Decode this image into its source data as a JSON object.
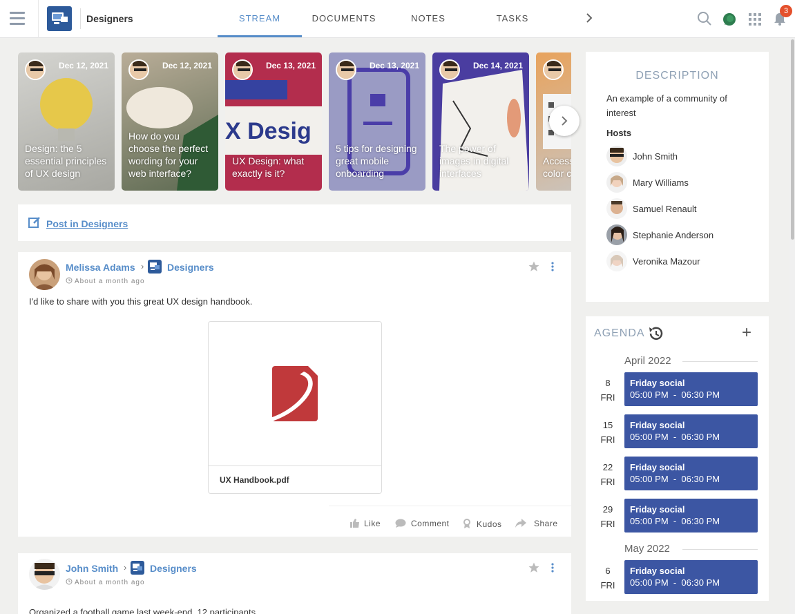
{
  "header": {
    "space_name": "Designers",
    "tabs": [
      "STREAM",
      "DOCUMENTS",
      "NOTES",
      "TASKS"
    ],
    "active_tab": "STREAM",
    "notification_count": "3"
  },
  "carousel": {
    "cards": [
      {
        "date": "Dec 12, 2021",
        "title": "Design: the 5 essential principles of UX design",
        "color": "#c9c9c5"
      },
      {
        "date": "Dec 12, 2021",
        "title": "How do you choose the perfect wording for your web interface?",
        "color": "#9a8a73"
      },
      {
        "date": "Dec 13, 2021",
        "title": "UX Design: what exactly is it?",
        "color": "#b5294a"
      },
      {
        "date": "Dec 13, 2021",
        "title": "5 tips for designing great mobile onboarding",
        "color": "#8e8fb8"
      },
      {
        "date": "Dec 14, 2021",
        "title": "The power of images in digital interfaces",
        "color": "#4b3aa0"
      },
      {
        "date": "",
        "title": "Access color c",
        "color": "#d69552"
      }
    ]
  },
  "composer": {
    "label": "Post in Designers"
  },
  "posts": [
    {
      "author": "Melissa Adams",
      "space": "Designers",
      "time": "About a month ago",
      "text": "I'd like to share with you this great UX design handbook.",
      "attachment": "UX Handbook.pdf",
      "actions": {
        "like": "Like",
        "comment": "Comment",
        "kudos": "Kudos",
        "share": "Share"
      }
    },
    {
      "author": "John Smith",
      "space": "Designers",
      "time": "About a month ago",
      "text": "Organized a football game last week-end. 12 participants."
    }
  ],
  "description": {
    "title": "DESCRIPTION",
    "text": "An example of a community of interest",
    "hosts_label": "Hosts",
    "hosts": [
      "John Smith",
      "Mary Williams",
      "Samuel Renault",
      "Stephanie Anderson",
      "Veronika Mazour"
    ]
  },
  "agenda": {
    "title": "AGENDA",
    "months": [
      "April 2022",
      "May 2022"
    ],
    "events": [
      {
        "day": "8",
        "weekday": "FRI",
        "title": "Friday social",
        "time": "05:00 PM  -  06:30 PM"
      },
      {
        "day": "15",
        "weekday": "FRI",
        "title": "Friday social",
        "time": "05:00 PM  -  06:30 PM"
      },
      {
        "day": "22",
        "weekday": "FRI",
        "title": "Friday social",
        "time": "05:00 PM  -  06:30 PM"
      },
      {
        "day": "29",
        "weekday": "FRI",
        "title": "Friday social",
        "time": "05:00 PM  -  06:30 PM"
      },
      {
        "day": "6",
        "weekday": "FRI",
        "title": "Friday social",
        "time": "05:00 PM  -  06:30 PM"
      }
    ]
  },
  "colors": {
    "accent": "#578dc9",
    "event": "#3c56a3",
    "badge": "#e4502c"
  }
}
